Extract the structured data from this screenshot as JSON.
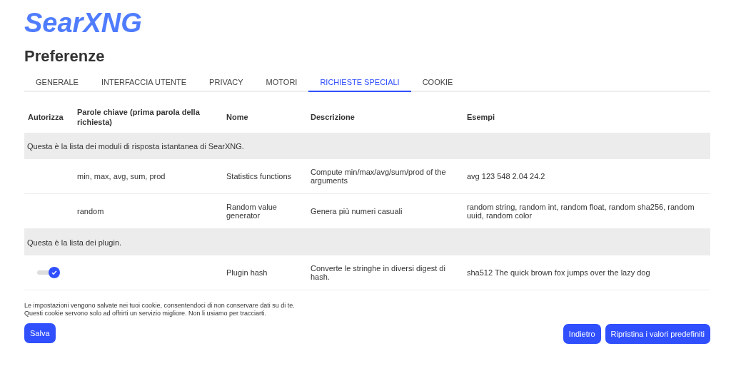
{
  "logo": "SearXNG",
  "title": "Preferenze",
  "tabs": [
    {
      "label": "GENERALE",
      "selected": false
    },
    {
      "label": "INTERFACCIA UTENTE",
      "selected": false
    },
    {
      "label": "PRIVACY",
      "selected": false
    },
    {
      "label": "MOTORI",
      "selected": false
    },
    {
      "label": "RICHIESTE SPECIALI",
      "selected": true
    },
    {
      "label": "COOKIE",
      "selected": false
    }
  ],
  "table": {
    "columns": [
      "Autorizza",
      "Parole chiave (prima parola della richiesta)",
      "Nome",
      "Descrizione",
      "Esempi"
    ],
    "rows": [
      {
        "kind": "group",
        "text": "Questa è la lista dei moduli di risposta istantanea di SearXNG."
      },
      {
        "kind": "answerer",
        "keywords": "min, max, avg, sum, prod",
        "name": "Statistics functions",
        "description": "Compute min/max/avg/sum/prod of the arguments",
        "examples": "avg 123 548 2.04 24.2"
      },
      {
        "kind": "answerer",
        "keywords": "random",
        "name": "Random value generator",
        "description": "Genera più numeri casuali",
        "examples": "random string, random int, random float, random sha256, random uuid, random color"
      },
      {
        "kind": "group",
        "text": "Questa è la lista dei plugin."
      },
      {
        "kind": "plugin",
        "allowed": true,
        "name": "Plugin hash",
        "description": "Converte le stringhe in diversi digest di hash.",
        "examples": "sha512 The quick brown fox jumps over the lazy dog"
      }
    ]
  },
  "notice": [
    "Le impostazioni vengono salvate nei tuoi cookie, consentendoci di non conservare dati su di te.",
    "Questi cookie servono solo ad offrirti un servizio migliore. Non li usiamo per tracciarti."
  ],
  "buttons": {
    "save": "Salva",
    "back": "Indietro",
    "reset": "Ripristina i valori predefiniti"
  }
}
